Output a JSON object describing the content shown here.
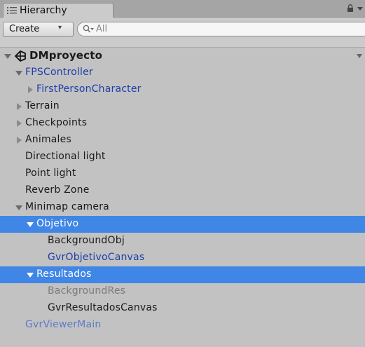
{
  "window": {
    "tab_label": "Hierarchy",
    "tab_icon": "hierarchy-list-icon",
    "lock_icon": "lock-icon",
    "panel_menu_icon": "panel-menu-icon"
  },
  "toolbar": {
    "create_label": "Create",
    "create_caret": "▾",
    "search_placeholder": "All",
    "search_icon": "search-icon"
  },
  "colors": {
    "panel_bg": "#c2c2c2",
    "selection": "#3f86e6",
    "prefab_text": "#1d3ea8",
    "disabled_text": "#7b7b7b"
  },
  "hierarchy": {
    "scene": {
      "label": "DMproyecto",
      "icon": "unity-scene-icon",
      "expanded": true
    },
    "items": [
      {
        "label": "FPSController",
        "depth": 1,
        "arrow": "expanded",
        "style": "prefab",
        "selected": false
      },
      {
        "label": "FirstPersonCharacter",
        "depth": 2,
        "arrow": "collapsed",
        "style": "prefab",
        "selected": false
      },
      {
        "label": "Terrain",
        "depth": 1,
        "arrow": "collapsed",
        "style": "normal",
        "selected": false
      },
      {
        "label": "Checkpoints",
        "depth": 1,
        "arrow": "collapsed",
        "style": "normal",
        "selected": false
      },
      {
        "label": "Animales",
        "depth": 1,
        "arrow": "collapsed",
        "style": "normal",
        "selected": false
      },
      {
        "label": "Directional light",
        "depth": 1,
        "arrow": "none",
        "style": "normal",
        "selected": false
      },
      {
        "label": "Point light",
        "depth": 1,
        "arrow": "none",
        "style": "normal",
        "selected": false
      },
      {
        "label": "Reverb Zone",
        "depth": 1,
        "arrow": "none",
        "style": "normal",
        "selected": false
      },
      {
        "label": "Minimap camera",
        "depth": 1,
        "arrow": "expanded",
        "style": "normal",
        "selected": false
      },
      {
        "label": "Objetivo",
        "depth": 2,
        "arrow": "expanded",
        "style": "selected",
        "selected": true
      },
      {
        "label": "BackgroundObj",
        "depth": 3,
        "arrow": "none",
        "style": "normal",
        "selected": false
      },
      {
        "label": "GvrObjetivoCanvas",
        "depth": 3,
        "arrow": "none",
        "style": "prefab",
        "selected": false
      },
      {
        "label": "Resultados",
        "depth": 2,
        "arrow": "expanded",
        "style": "selected",
        "selected": true
      },
      {
        "label": "BackgroundRes",
        "depth": 3,
        "arrow": "none",
        "style": "disabled",
        "selected": false
      },
      {
        "label": "GvrResultadosCanvas",
        "depth": 3,
        "arrow": "none",
        "style": "normal",
        "selected": false
      },
      {
        "label": "GvrViewerMain",
        "depth": 1,
        "arrow": "none",
        "style": "prefab-pale",
        "selected": false
      }
    ]
  }
}
